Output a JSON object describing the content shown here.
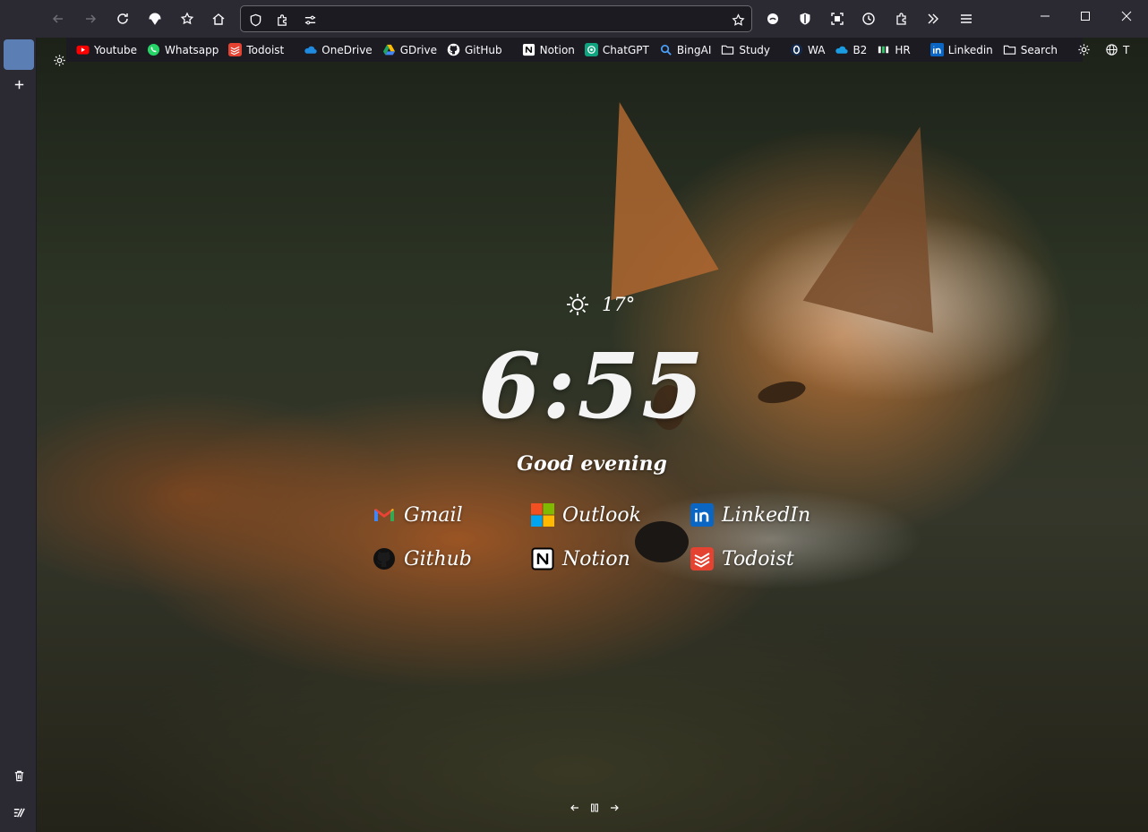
{
  "browser": {
    "url": "",
    "window_controls": [
      "minimize",
      "maximize",
      "close"
    ]
  },
  "bookmarks": [
    {
      "label": "Youtube",
      "icon": "youtube-icon",
      "color": "#ff0000"
    },
    {
      "label": "Whatsapp",
      "icon": "whatsapp-icon",
      "color": "#25d366"
    },
    {
      "label": "Todoist",
      "icon": "todoist-icon",
      "color": "#e44332"
    },
    {
      "label": "OneDrive",
      "icon": "onedrive-icon",
      "color": "#0078d4"
    },
    {
      "label": "GDrive",
      "icon": "gdrive-icon",
      "color": "#fbbc04"
    },
    {
      "label": "GitHub",
      "icon": "github-icon",
      "color": "#ffffff"
    },
    {
      "label": "Notion",
      "icon": "notion-icon",
      "color": "#ffffff"
    },
    {
      "label": "ChatGPT",
      "icon": "chatgpt-icon",
      "color": "#10a37f"
    },
    {
      "label": "BingAI",
      "icon": "search-icon",
      "color": "#4aa3ff"
    },
    {
      "label": "Study",
      "icon": "folder-icon",
      "color": "#fbfbfe"
    },
    {
      "label": "WA",
      "icon": "wa-icon",
      "color": "#1a4b8f"
    },
    {
      "label": "B2",
      "icon": "cloud-icon",
      "color": "#1b9be0"
    },
    {
      "label": "HR",
      "icon": "hr-icon",
      "color": "#2ec866"
    },
    {
      "label": "Linkedin",
      "icon": "linkedin-icon",
      "color": "#0a66c2"
    },
    {
      "label": "Search",
      "icon": "folder-icon",
      "color": "#fbfbfe"
    },
    {
      "label": "T",
      "icon": "globe-icon",
      "color": "#fbfbfe"
    }
  ],
  "weather": {
    "temp": "17°",
    "icon": "sun-icon"
  },
  "clock": {
    "time": "6:55"
  },
  "greeting": "Good evening",
  "quick_links": [
    {
      "label": "Gmail",
      "icon": "gmail-icon"
    },
    {
      "label": "Outlook",
      "icon": "microsoft-icon"
    },
    {
      "label": "LinkedIn",
      "icon": "linkedin-icon"
    },
    {
      "label": "Github",
      "icon": "github-icon"
    },
    {
      "label": "Notion",
      "icon": "notion-icon"
    },
    {
      "label": "Todoist",
      "icon": "todoist-icon"
    }
  ],
  "colors": {
    "toolbar": "#2b2a33",
    "bookmark_bar": "#1c1b22",
    "sidebar_active": "#5b7fb5"
  }
}
